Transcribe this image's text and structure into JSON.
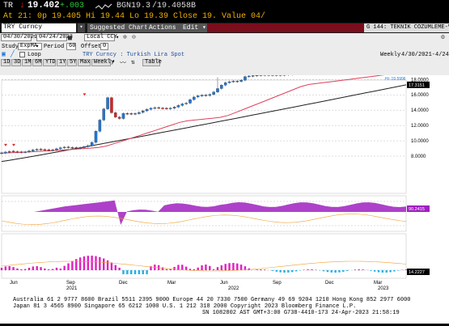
{
  "quote": {
    "ticker": "TR",
    "last": "19.402",
    "change": "+.003",
    "bgn": "BGN19.3 /19.4058B",
    "line2": "At 21: 0p 19.405 Hi 19.44 Lo 19.39 Close 19. Value 04/"
  },
  "toolbar": {
    "input_value": "TRY Curncy",
    "suggested": "Suggested Charts",
    "actions": "Actions",
    "edit": "Edit",
    "teknik": "G 144: TEKNIK COZUMLEME-V1"
  },
  "controls": {
    "date_from": "04/30/2021",
    "date_to": "04/24/2023",
    "local": "Local CCY",
    "study": "Study",
    "study_val": "ExpMA",
    "period": "Period",
    "period_val": "60",
    "offset": "Offset",
    "offset_val": "0",
    "loop": "Loop",
    "security_name": "TRY Curncy : Turkish Lira Spot",
    "freq": "Weekly",
    "range": "4/30/2021-4/24/2023",
    "table": "Table"
  },
  "ranges": [
    "1D",
    "3D",
    "1M",
    "6M",
    "YTD",
    "1Y",
    "5Y",
    "Max",
    "Weekly"
  ],
  "axis": {
    "y_ticks": [
      "20.0000",
      "18.0000",
      "16.0000",
      "14.0000",
      "12.0000",
      "10.0000",
      "8.0000"
    ],
    "hi_label": "Hi: 19.5996",
    "last_tag": "19.4028",
    "ema_tag": "17.3151",
    "rsi_tag": "90.2415",
    "macd_tag": "14.2227",
    "x_ticks": [
      "Jun",
      "Sep",
      "Dec",
      "Mar",
      "Jun",
      "Sep",
      "Dec",
      "Mar"
    ],
    "years": [
      "2021",
      "2022",
      "2023"
    ]
  },
  "colors": {
    "up": "#1f77d8",
    "down": "#e02020",
    "ema_short": "#e0405a",
    "ema_long": "#202020",
    "rsi": "#a020c0",
    "macd_up": "#e020c0",
    "macd_down": "#20b0e8"
  },
  "footer": {
    "l1": "Australia 61 2 9777 8600 Brazil 5511 2395 9000 Europe 44 20 7330 7500 Germany 49 69 9204 1210 Hong Kong 852 2977 6000",
    "l2": "Japan 81 3 4565 8900        Singapore 65 6212 1000        U.S. 1 212 318 2000        Copyright 2023 Bloomberg Finance L.P.",
    "l3": "SN 1082802 AST  GMT+3:00 G738-4410-173 24-Apr-2023 21:58:19"
  }
}
